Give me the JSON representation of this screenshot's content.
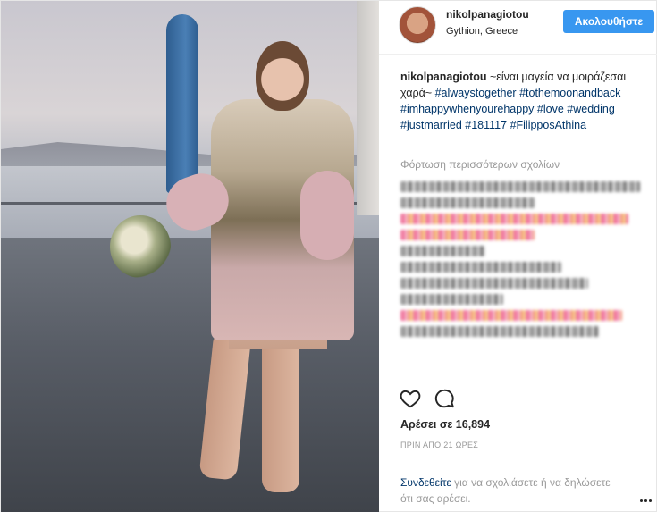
{
  "post": {
    "username": "nikolpanagiotou",
    "location": "Gythion, Greece",
    "follow_label": "Ακολουθήστε",
    "caption_user": "nikolpanagiotou",
    "caption_text": " ~είναι μαγεία να μοιράζεσαι χαρά~ ",
    "hashtags": [
      "#alwaystogether",
      "#tothemoonandback",
      "#imhappywhenyourehappy",
      "#love",
      "#wedding",
      "#justmarried",
      "#181117",
      "#FilipposAthina"
    ],
    "load_more": "Φόρτωση περισσότερων σχολίων",
    "likes": "Αρέσει σε 16,894",
    "time_ago": "ΠΡΙΝ ΑΠΟ 21 ΩΡΕΣ",
    "login_link": "Συνδεθείτε",
    "login_rest": " για να σχολιάσετε ή να δηλώσετε ότι σας αρέσει."
  },
  "icons": {
    "like": "heart-icon",
    "comment": "comment-bubble-icon",
    "more": "ellipsis-icon"
  },
  "colors": {
    "follow_button": "#3897f0",
    "hashtag": "#003569",
    "muted": "#999999"
  }
}
